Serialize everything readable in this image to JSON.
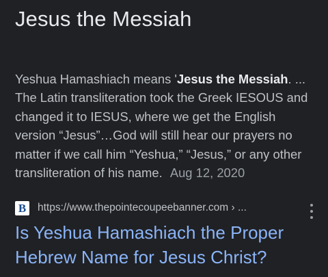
{
  "featured": {
    "heading": "Jesus the Messiah",
    "snippet_before": "Yeshua Hamashiach means '",
    "snippet_bold": "Jesus the Messiah",
    "snippet_after": ". ... The Latin transliteration took the Greek IESOUS and changed it to IESUS, where we get the English version “Jesus”…God will still hear our prayers no matter if we call him “Yeshua,” “Jesus,” or any other transliteration of his name.",
    "date": "Aug 12, 2020"
  },
  "result": {
    "favicon_text": "B",
    "favicon_icon": "newspaper-logo-icon",
    "url": "https://www.thepointecoupeebanner.com › ...",
    "title": "Is Yeshua Hamashiach the Proper Hebrew Name for Jesus Christ?",
    "more_icon": "vertical-dots-icon"
  },
  "colors": {
    "background": "#202124",
    "heading": "#e8eaed",
    "body_text": "#bdc1c6",
    "muted": "#9aa0a6",
    "link": "#8ab4f8"
  }
}
